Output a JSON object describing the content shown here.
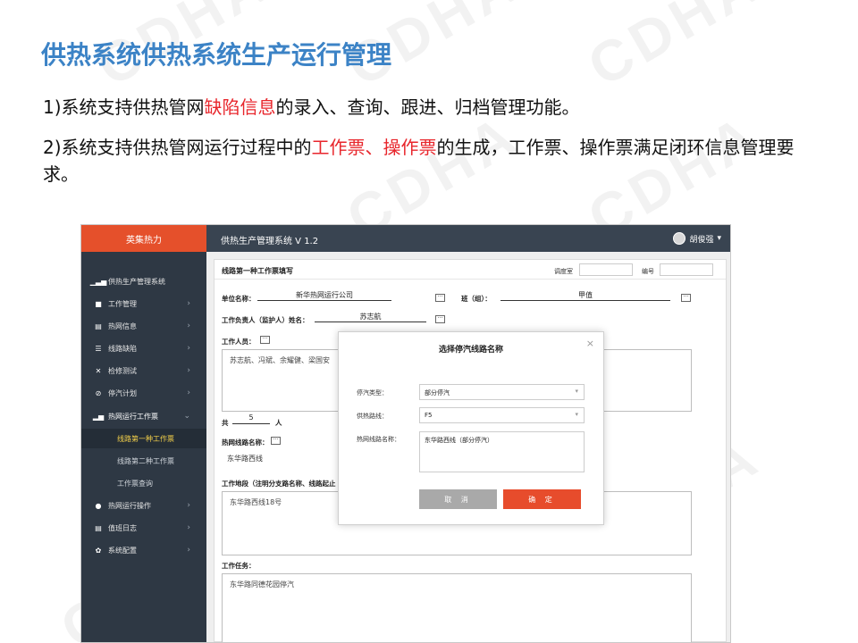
{
  "slide": {
    "title": "供热系统供热系统生产运行管理",
    "p1_before": "1)系统支持供热管网",
    "p1_highlight": "缺陷信息",
    "p1_after": "的录入、查询、跟进、归档管理功能。",
    "p2_before": "2)系统支持供热管网运行过程中的",
    "p2_highlight": "工作票、操作票",
    "p2_after": "的生成，工作票、操作票满足闭环信息管理要求。",
    "highlight_color": "#e8262c",
    "watermark": "CDHA"
  },
  "app": {
    "brand": "英集热力",
    "system_title": "供热生产管理系统 V 1.2",
    "user_name": "胡俊强",
    "sidebar": [
      {
        "label": "供热生产管理系统",
        "icon": "chart-icon",
        "chevron": ""
      },
      {
        "label": "工作管理",
        "icon": "folder-icon",
        "chevron": "›"
      },
      {
        "label": "热网信息",
        "icon": "doc-icon",
        "chevron": "›"
      },
      {
        "label": "线路缺陷",
        "icon": "list-icon",
        "chevron": "›"
      },
      {
        "label": "检修测试",
        "icon": "tools-icon",
        "chevron": "›"
      },
      {
        "label": "停汽计划",
        "icon": "ban-icon",
        "chevron": "›"
      },
      {
        "label": "热网运行工作票",
        "icon": "bar-chart-icon",
        "chevron": "⌄"
      },
      {
        "label": "线路第一种工作票",
        "sub": true,
        "active": true
      },
      {
        "label": "线路第二种工作票",
        "sub": true
      },
      {
        "label": "工作票查询",
        "sub": true
      },
      {
        "label": "热网运行操作",
        "icon": "play-icon",
        "chevron": "›"
      },
      {
        "label": "值班日志",
        "icon": "doc-icon",
        "chevron": "›"
      },
      {
        "label": "系统配置",
        "icon": "gear-icon",
        "chevron": "›"
      }
    ],
    "form": {
      "title": "线路第一种工作票填写",
      "dispatch_label": "调度室",
      "number_label": "编号",
      "unit_label": "单位名称：",
      "unit_value": "新华热网运行公司",
      "team_label": "班（组）：",
      "team_value": "甲值",
      "leader_label": "工作负责人（监护人）姓名：",
      "leader_value": "苏志航",
      "members_label": "工作人员：",
      "members_value": "苏志航、冯斌、余耀健、梁国安",
      "total_prefix": "共",
      "total_value": "5",
      "total_suffix": "人",
      "line_name_label": "热网线路名称：",
      "line_name_value": "东华路西线",
      "location_label": "工作地段（注明分支路名称、线路起止",
      "location_value": "东华路西线18号",
      "task_label": "工作任务：",
      "task_value": "东华路同德花园停汽"
    },
    "modal": {
      "title": "选择停汽线路名称",
      "close": "×",
      "type_label": "停汽类型：",
      "type_value": "部分停汽",
      "line_label": "供热路线：",
      "line_value": "F5",
      "name_label": "热网线路名称：",
      "name_value": "东华路西线（部分停汽）",
      "cancel": "取 消",
      "confirm": "确 定"
    }
  }
}
